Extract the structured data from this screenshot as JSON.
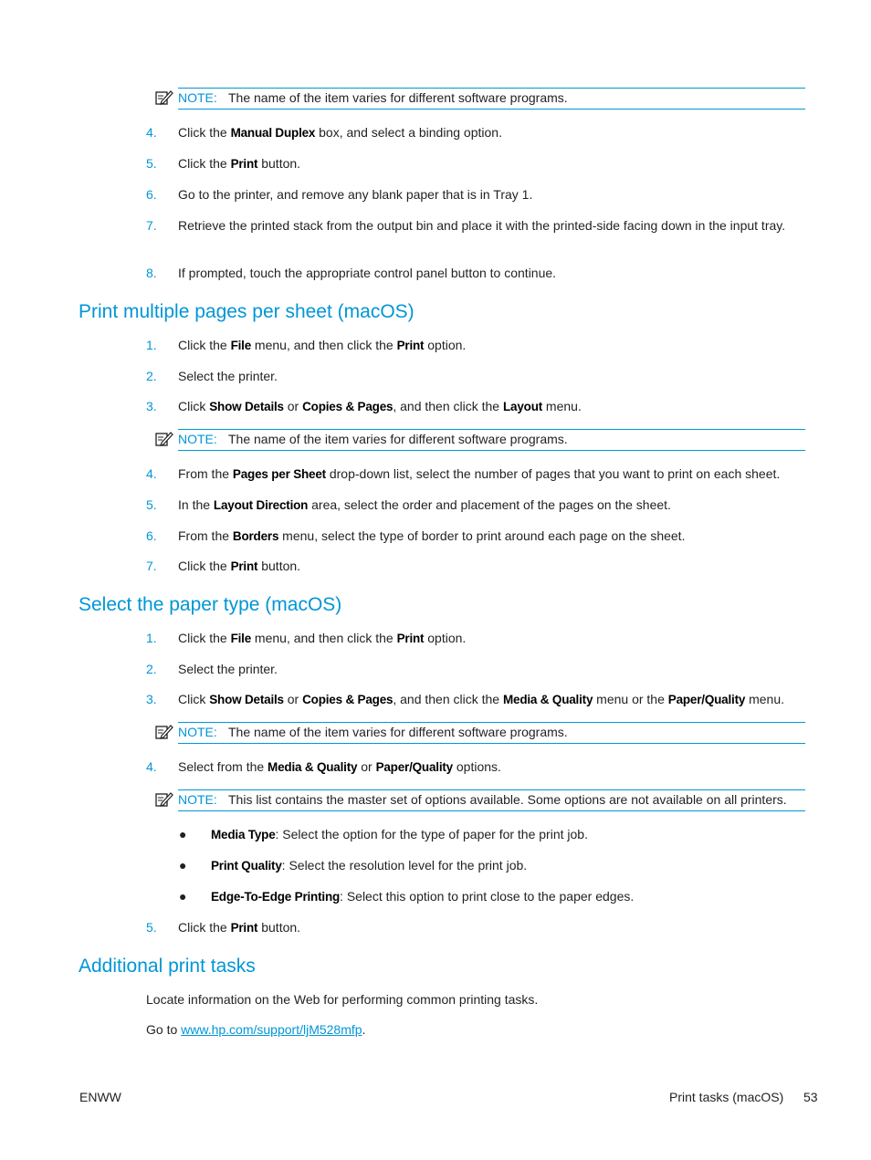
{
  "notes": {
    "label": "NOTE:",
    "varies": "The name of the item varies for different software programs.",
    "master": "This list contains the master set of options available. Some options are not available on all printers."
  },
  "section0": {
    "steps": [
      {
        "num": "4.",
        "pre": "Click the ",
        "ui1": "Manual Duplex",
        "post": " box, and select a binding option."
      },
      {
        "num": "5.",
        "pre": "Click the ",
        "ui1": "Print",
        "post": " button."
      },
      {
        "num": "6.",
        "text": "Go to the printer, and remove any blank paper that is in Tray 1."
      },
      {
        "num": "7.",
        "text": "Retrieve the printed stack from the output bin and place it with the printed-side facing down in the input tray."
      },
      {
        "num": "8.",
        "text": "If prompted, touch the appropriate control panel button to continue."
      }
    ]
  },
  "section1": {
    "title": "Print multiple pages per sheet (macOS)",
    "steps": [
      {
        "num": "1.",
        "pre": "Click the ",
        "ui1": "File",
        "mid": " menu, and then click the ",
        "ui2": "Print",
        "post": " option."
      },
      {
        "num": "2.",
        "text": "Select the printer."
      },
      {
        "num": "3.",
        "pre": "Click ",
        "ui1": "Show Details",
        "mid": " or ",
        "ui2": "Copies & Pages",
        "mid2": ", and then click the ",
        "ui3": "Layout",
        "post": " menu."
      },
      {
        "num": "4.",
        "pre": "From the ",
        "ui1": "Pages per Sheet",
        "post": " drop-down list, select the number of pages that you want to print on each sheet."
      },
      {
        "num": "5.",
        "pre": "In the ",
        "ui1": "Layout Direction",
        "post": " area, select the order and placement of the pages on the sheet."
      },
      {
        "num": "6.",
        "pre": "From the ",
        "ui1": "Borders",
        "post": " menu, select the type of border to print around each page on the sheet."
      },
      {
        "num": "7.",
        "pre": "Click the ",
        "ui1": "Print",
        "post": " button."
      }
    ]
  },
  "section2": {
    "title": "Select the paper type (macOS)",
    "steps": [
      {
        "num": "1.",
        "pre": "Click the ",
        "ui1": "File",
        "mid": " menu, and then click the ",
        "ui2": "Print",
        "post": " option."
      },
      {
        "num": "2.",
        "text": "Select the printer."
      },
      {
        "num": "3.",
        "pre": "Click ",
        "ui1": "Show Details",
        "mid": " or ",
        "ui2": "Copies & Pages",
        "mid2": ", and then click the ",
        "ui3": "Media & Quality",
        "mid3": " menu or the ",
        "ui4": "Paper/Quality",
        "post": " menu."
      },
      {
        "num": "4.",
        "pre": "Select from the ",
        "ui1": "Media & Quality",
        "mid": " or ",
        "ui2": "Paper/Quality",
        "post": " options."
      },
      {
        "num": "5.",
        "pre": "Click the ",
        "ui1": "Print",
        "post": " button."
      }
    ],
    "bullets": [
      {
        "ui": "Media Type",
        "text": ": Select the option for the type of paper for the print job."
      },
      {
        "ui": "Print Quality",
        "text": ": Select the resolution level for the print job."
      },
      {
        "ui": "Edge-To-Edge Printing",
        "text": ": Select this option to print close to the paper edges."
      }
    ]
  },
  "section3": {
    "title": "Additional print tasks",
    "intro": "Locate information on the Web for performing common printing tasks.",
    "goto_pre": "Go to ",
    "link": "www.hp.com/support/ljM528mfp",
    "goto_post": "."
  },
  "footer": {
    "left": "ENWW",
    "section": "Print tasks (macOS)",
    "page": "53"
  }
}
